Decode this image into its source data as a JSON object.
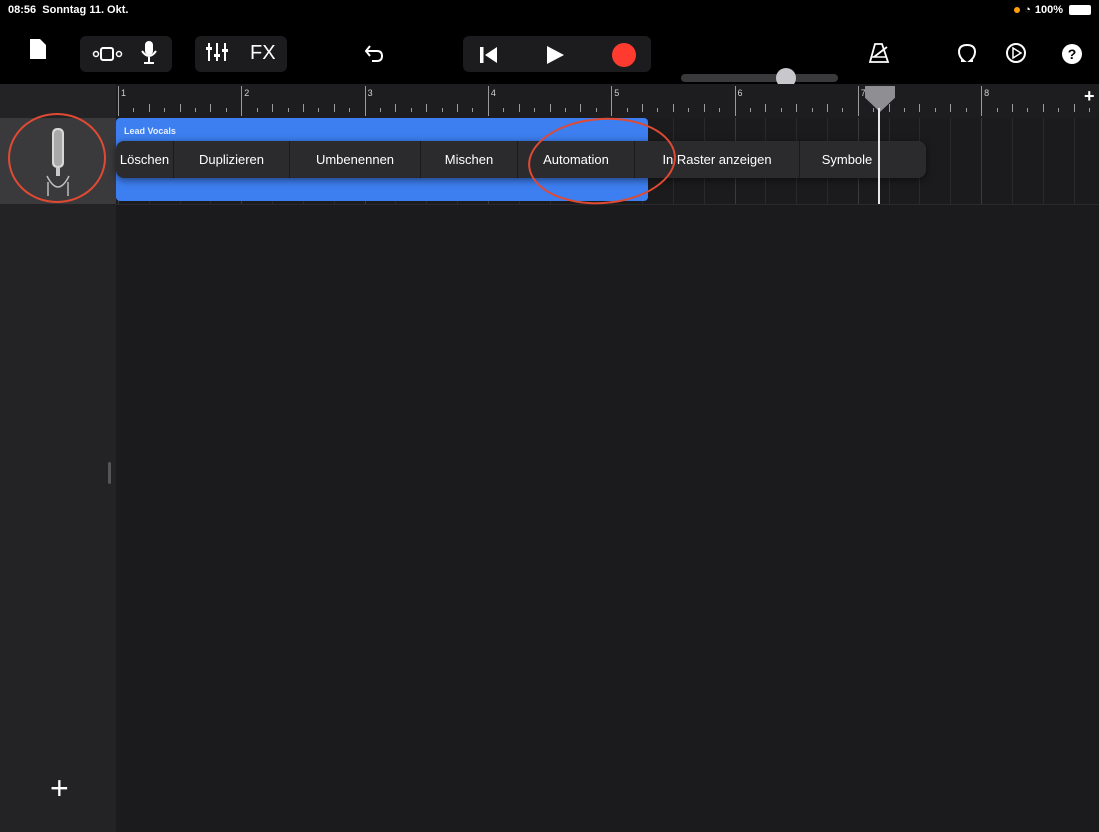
{
  "status_bar": {
    "time": "08:56",
    "date": "Sonntag 11. Okt.",
    "battery": "100%"
  },
  "toolbar": {
    "icons": [
      "document-icon",
      "track-view-icon",
      "microphone-icon",
      "mixer-icon",
      "undo-icon",
      "rewind-icon",
      "play-icon",
      "record-icon",
      "metronome-icon",
      "loop-icon",
      "settings-icon",
      "help-icon"
    ],
    "fx_label": "FX",
    "master_volume": 0.67,
    "record_color": "#ff3b30"
  },
  "ruler": {
    "bars": [
      "1",
      "2",
      "3",
      "4",
      "5",
      "6",
      "7",
      "8"
    ],
    "add_label": "+"
  },
  "track": {
    "name": "Lead Vocals",
    "region_color": "#3d7ef0"
  },
  "context_menu": {
    "items": [
      "Löschen",
      "Duplizieren",
      "Umbenennen",
      "Mischen",
      "Automation",
      "In Raster anzeigen",
      "Symbole"
    ]
  },
  "sidebar": {
    "add_track_label": "+"
  },
  "accent": {
    "annotation": "#e04a33"
  }
}
